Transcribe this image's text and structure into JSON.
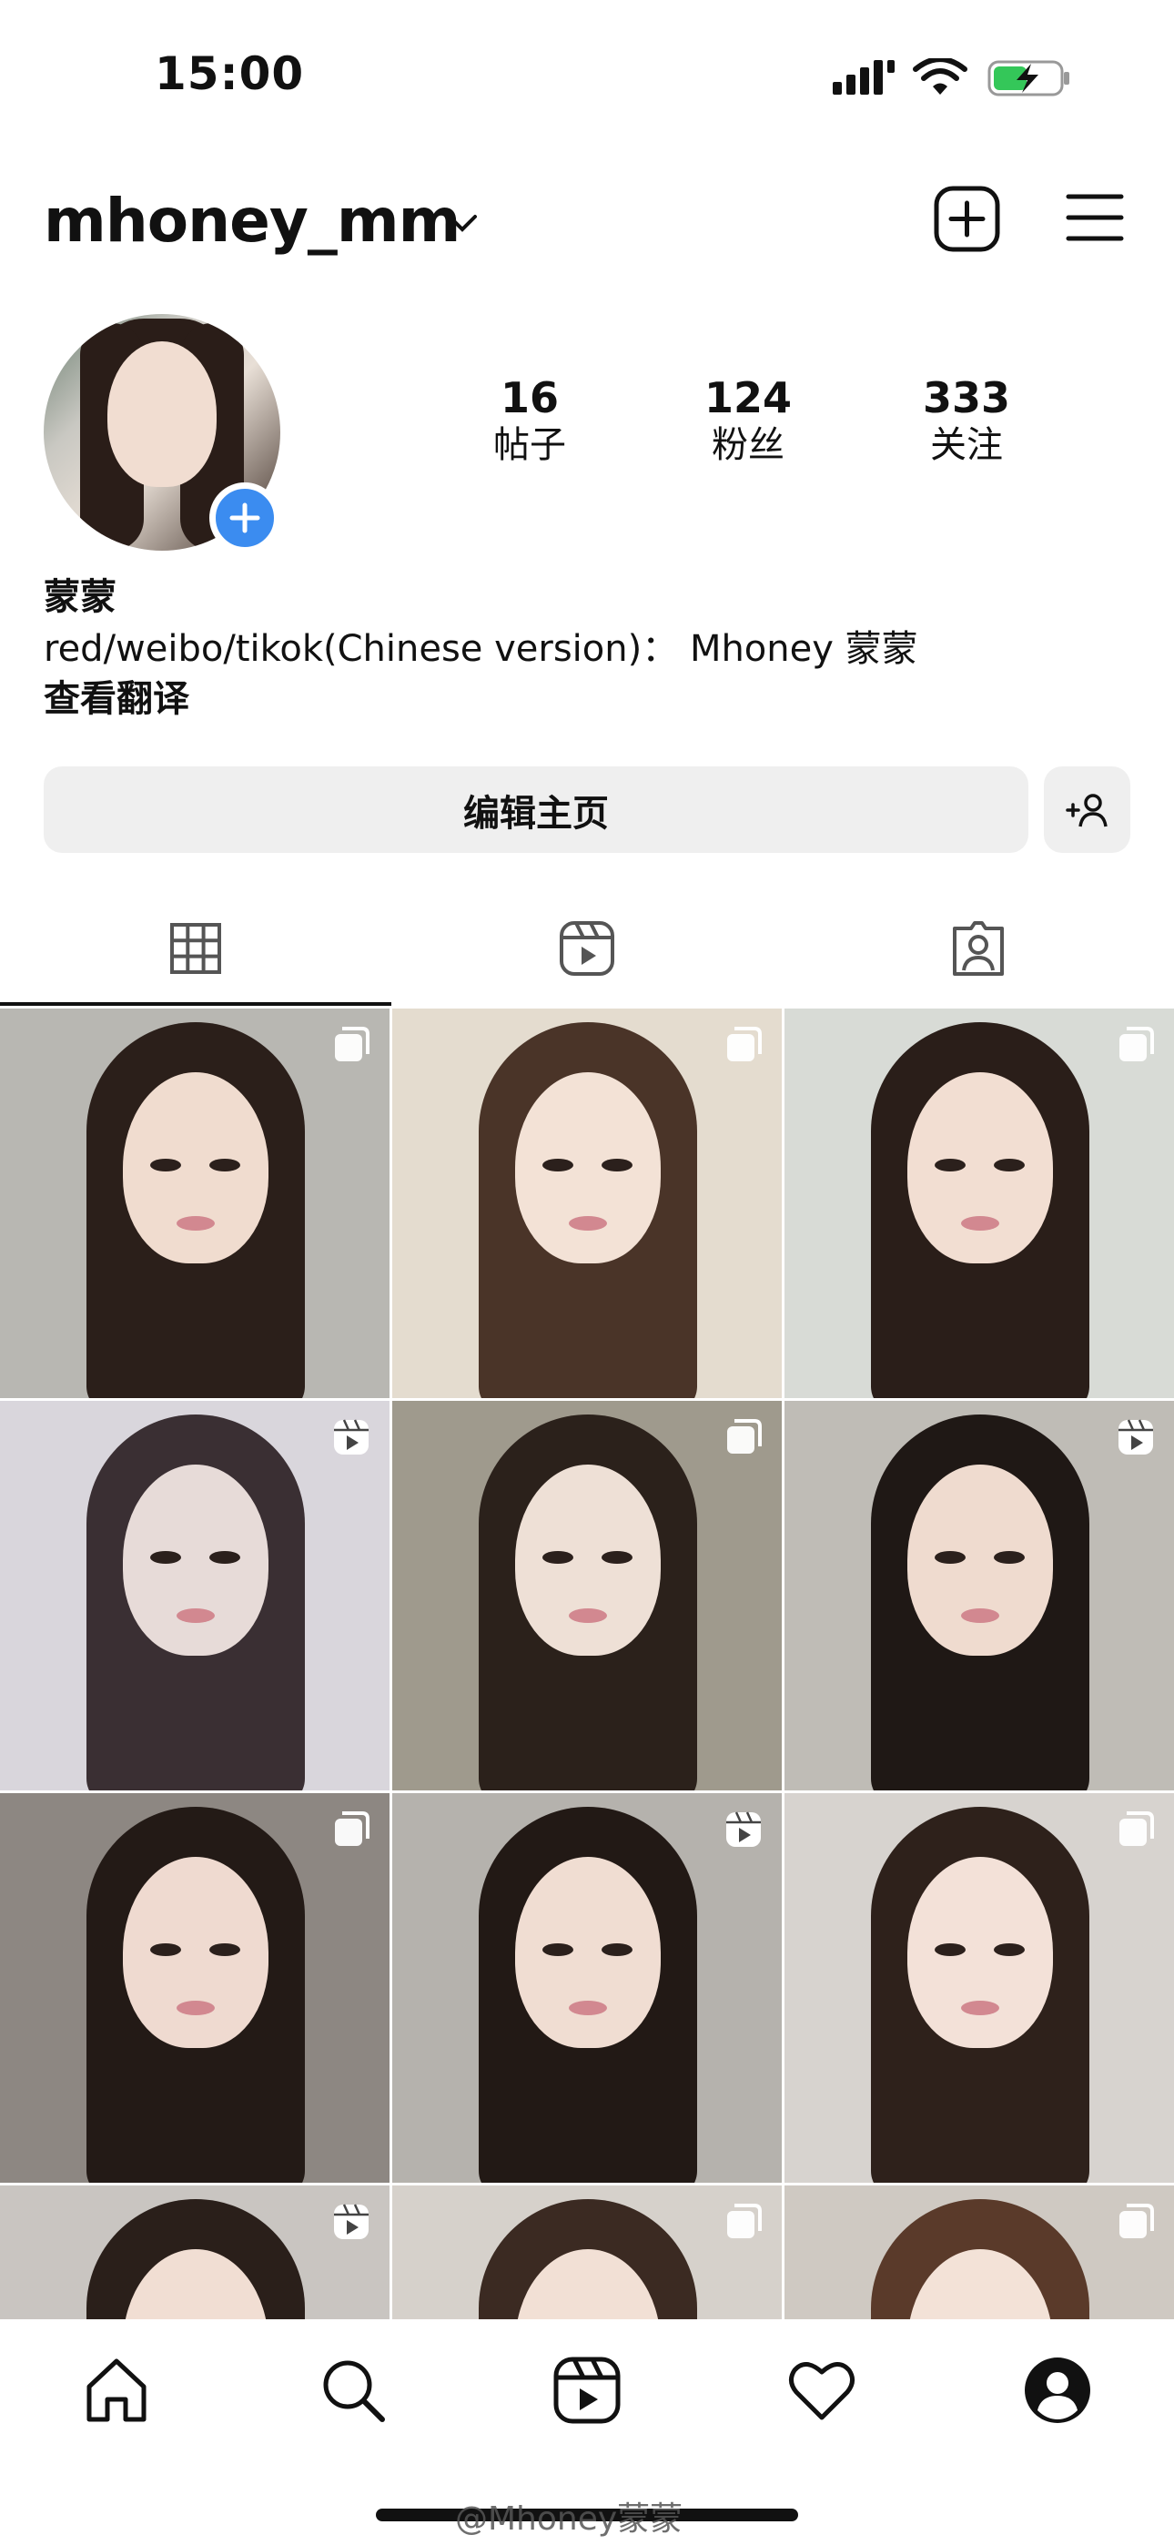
{
  "status": {
    "time": "15:00"
  },
  "header": {
    "username": "mhoney_mm"
  },
  "profile": {
    "name": "蒙蒙",
    "bio": "red/weibo/tikok(Chinese version)： Mhoney 蒙蒙",
    "translate": "查看翻译",
    "stats": [
      {
        "num": "16",
        "label": "帖子"
      },
      {
        "num": "124",
        "label": "粉丝"
      },
      {
        "num": "333",
        "label": "关注"
      }
    ],
    "edit_label": "编辑主页"
  },
  "tabs": [
    "grid-icon",
    "reels-icon",
    "tagged-icon"
  ],
  "grid": [
    {
      "badge": "multi",
      "bg": "#b8b7b2",
      "hair": "#2b1f1a",
      "skin": "#f0dccf"
    },
    {
      "badge": "multi",
      "bg": "#e4dccf",
      "hair": "#4a3428",
      "skin": "#f3e2d6"
    },
    {
      "badge": "multi",
      "bg": "#d8dbd6",
      "hair": "#2a1e19",
      "skin": "#f2ded2"
    },
    {
      "badge": "reel",
      "bg": "#d9d6dc",
      "hair": "#3a2f33",
      "skin": "#e7dbd8"
    },
    {
      "badge": "multi",
      "bg": "#9f9a8d",
      "hair": "#2b211b",
      "skin": "#eee0d6"
    },
    {
      "badge": "reel",
      "bg": "#bfbcb6",
      "hair": "#1f1815",
      "skin": "#efdbcf"
    },
    {
      "badge": "multi",
      "bg": "#8d8782",
      "hair": "#231a16",
      "skin": "#efdad0"
    },
    {
      "badge": "reel",
      "bg": "#b5b2ad",
      "hair": "#221915",
      "skin": "#f0ddd2"
    },
    {
      "badge": "multi",
      "bg": "#d7d3cf",
      "hair": "#2e211b",
      "skin": "#f3e1d8"
    },
    {
      "badge": "reel",
      "bg": "#c9c5c1",
      "hair": "#2a1f1a",
      "skin": "#f1ded3"
    },
    {
      "badge": "multi",
      "bg": "#d6d1cb",
      "hair": "#3b2a22",
      "skin": "#f2e0d5"
    },
    {
      "badge": "multi",
      "bg": "#cfc9c2",
      "hair": "#5a3a2a",
      "skin": "#f3e2d7"
    }
  ],
  "nav": [
    "home-icon",
    "search-icon",
    "reels-icon",
    "heart-icon",
    "profile-icon"
  ],
  "watermark": "@Mhoney蒙蒙",
  "colors": {
    "accent": "#3b8cf0",
    "button_bg": "#efefef"
  }
}
